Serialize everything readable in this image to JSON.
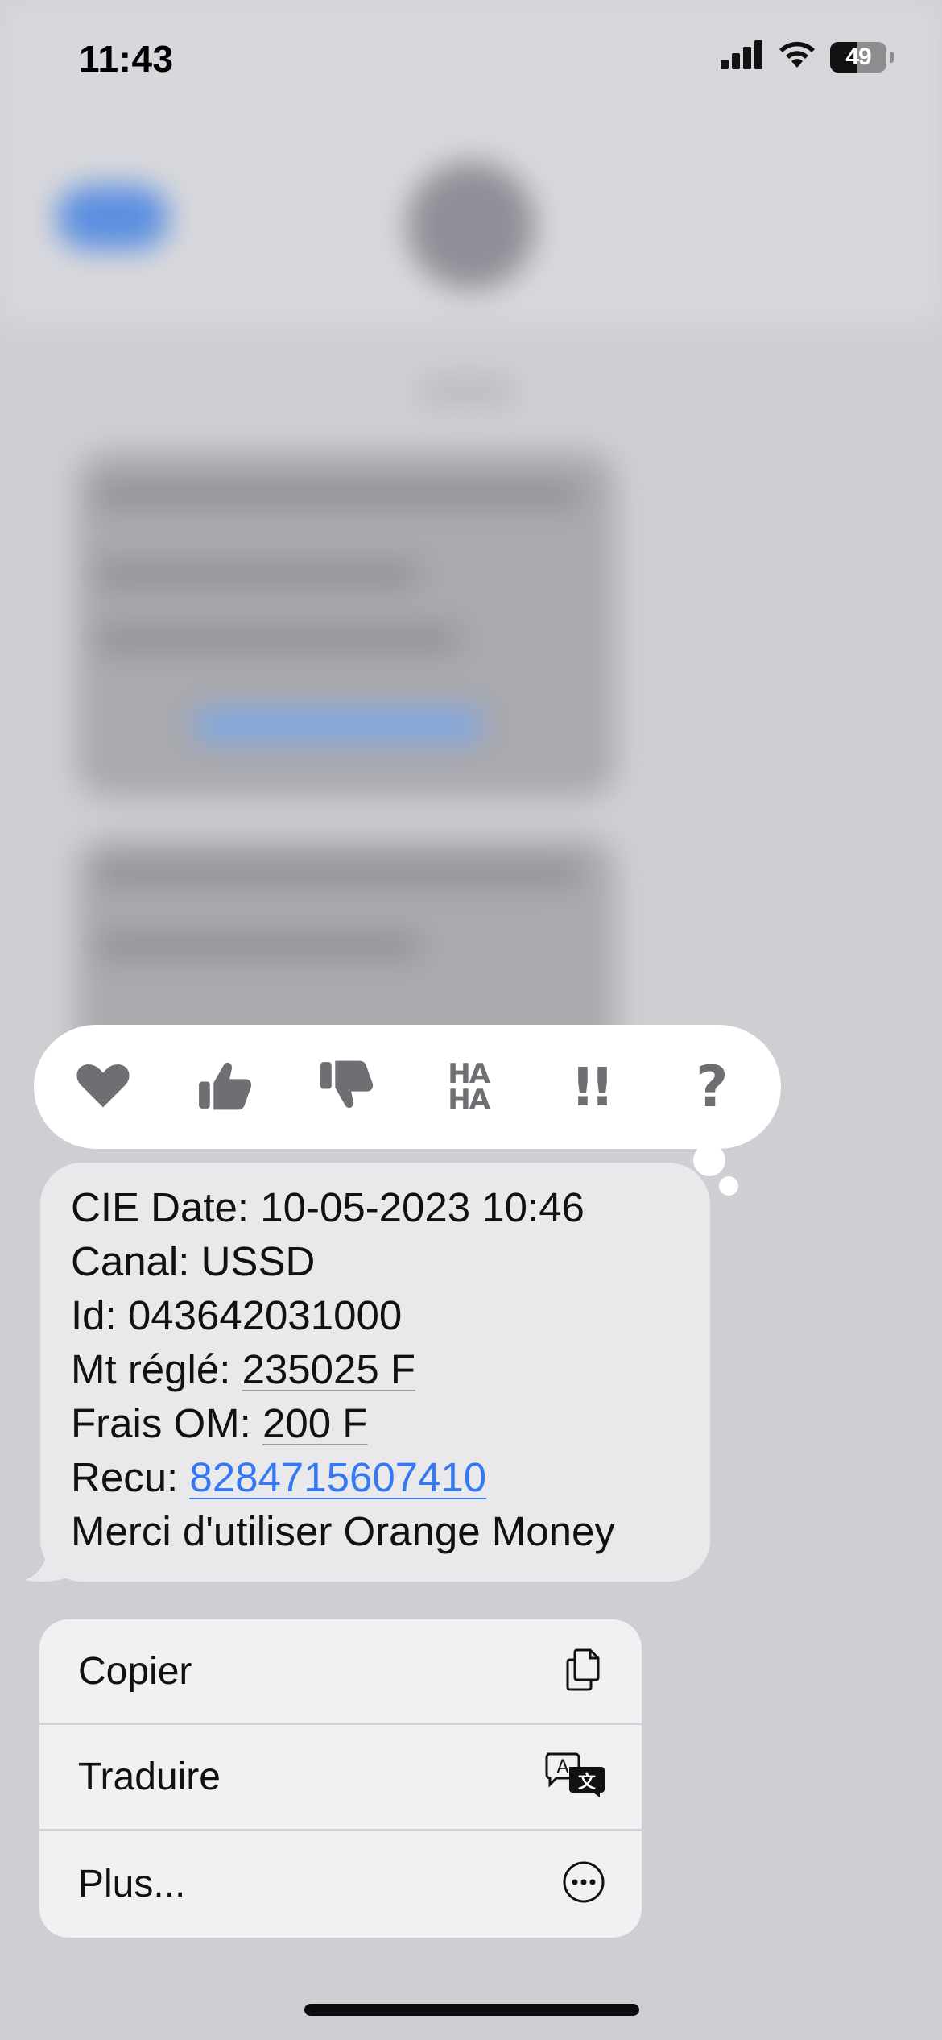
{
  "status_bar": {
    "time": "11:43",
    "battery": "49"
  },
  "tapbacks": [
    {
      "icon": "heart-icon"
    },
    {
      "icon": "thumbs-up-icon"
    },
    {
      "icon": "thumbs-down-icon"
    },
    {
      "icon": "haha-icon",
      "line1": "HA",
      "line2": "HA"
    },
    {
      "icon": "exclamation-icon",
      "text": "!!"
    },
    {
      "icon": "question-icon",
      "text": "?"
    }
  ],
  "message": {
    "line1": "CIE Date: 10-05-2023 10:46",
    "line2": "Canal: USSD",
    "line3": "Id: 043642031000",
    "line4_label": "Mt réglé: ",
    "line4_value": "235025 F",
    "line5_label": "Frais OM: ",
    "line5_value": "200 F",
    "line6_label": "Recu: ",
    "line6_link": "8284715607410",
    "line7": "Merci d'utiliser Orange Money",
    "link_color": "#3478f6",
    "bubble_color": "#e9e9eb"
  },
  "context_menu": {
    "items": [
      {
        "label": "Copier",
        "icon": "copy-icon"
      },
      {
        "label": "Traduire",
        "icon": "translate-icon"
      },
      {
        "label": "Plus...",
        "icon": "more-icon"
      }
    ]
  }
}
